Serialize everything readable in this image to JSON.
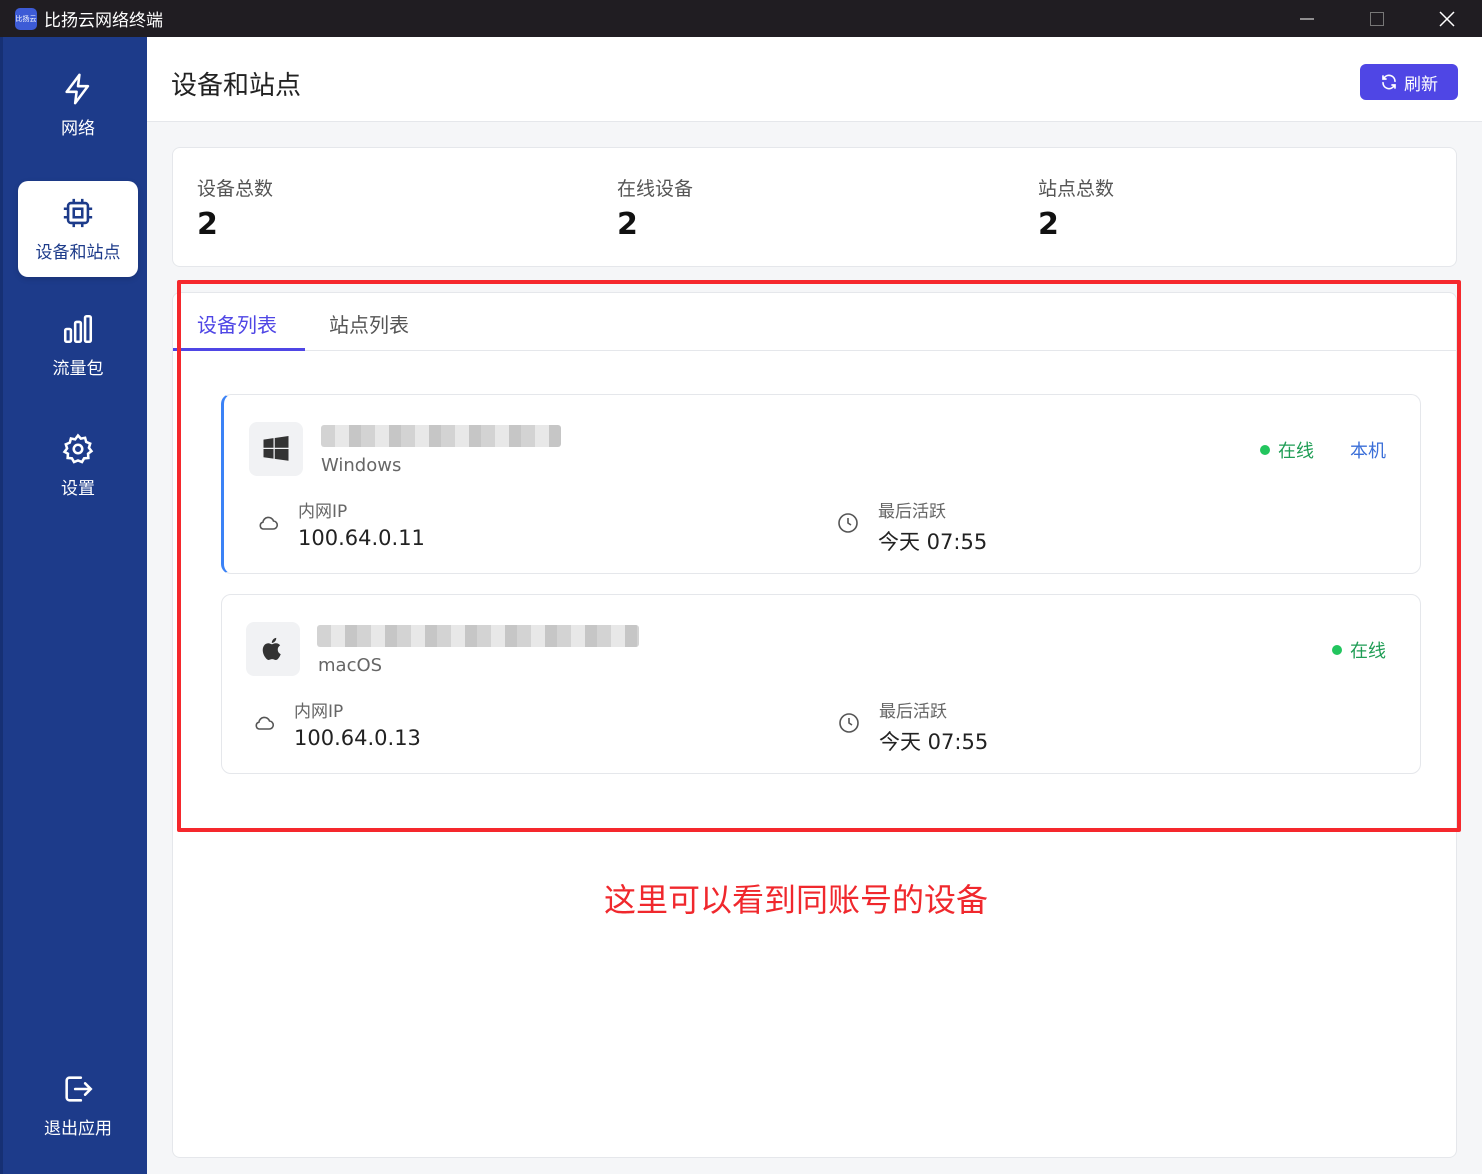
{
  "window": {
    "title": "比扬云网络终端",
    "app_icon_text": "比扬云"
  },
  "sidebar": {
    "items": [
      {
        "label": "网络",
        "icon": "lightning-icon"
      },
      {
        "label": "设备和站点",
        "icon": "chip-icon",
        "active": true
      },
      {
        "label": "流量包",
        "icon": "bar-chart-icon"
      },
      {
        "label": "设置",
        "icon": "gear-icon"
      }
    ],
    "logout_label": "退出应用"
  },
  "header": {
    "title": "设备和站点",
    "refresh_label": "刷新"
  },
  "stats": {
    "total_devices_label": "设备总数",
    "total_devices": "2",
    "online_devices_label": "在线设备",
    "online_devices": "2",
    "total_sites_label": "站点总数",
    "total_sites": "2"
  },
  "tabs": {
    "devices": "设备列表",
    "sites": "站点列表"
  },
  "devices": [
    {
      "os": "Windows",
      "status": "在线",
      "local_tag": "本机",
      "ip_label": "内网IP",
      "ip": "100.64.0.11",
      "last_active_label": "最后活跃",
      "last_active": "今天 07:55"
    },
    {
      "os": "macOS",
      "status": "在线",
      "ip_label": "内网IP",
      "ip": "100.64.0.13",
      "last_active_label": "最后活跃",
      "last_active": "今天 07:55"
    }
  ],
  "annotation": "这里可以看到同账号的设备",
  "colors": {
    "sidebar": "#1d3b8a",
    "accent": "#4f46e5",
    "online": "#22c55e",
    "highlight": "#f5282d"
  }
}
